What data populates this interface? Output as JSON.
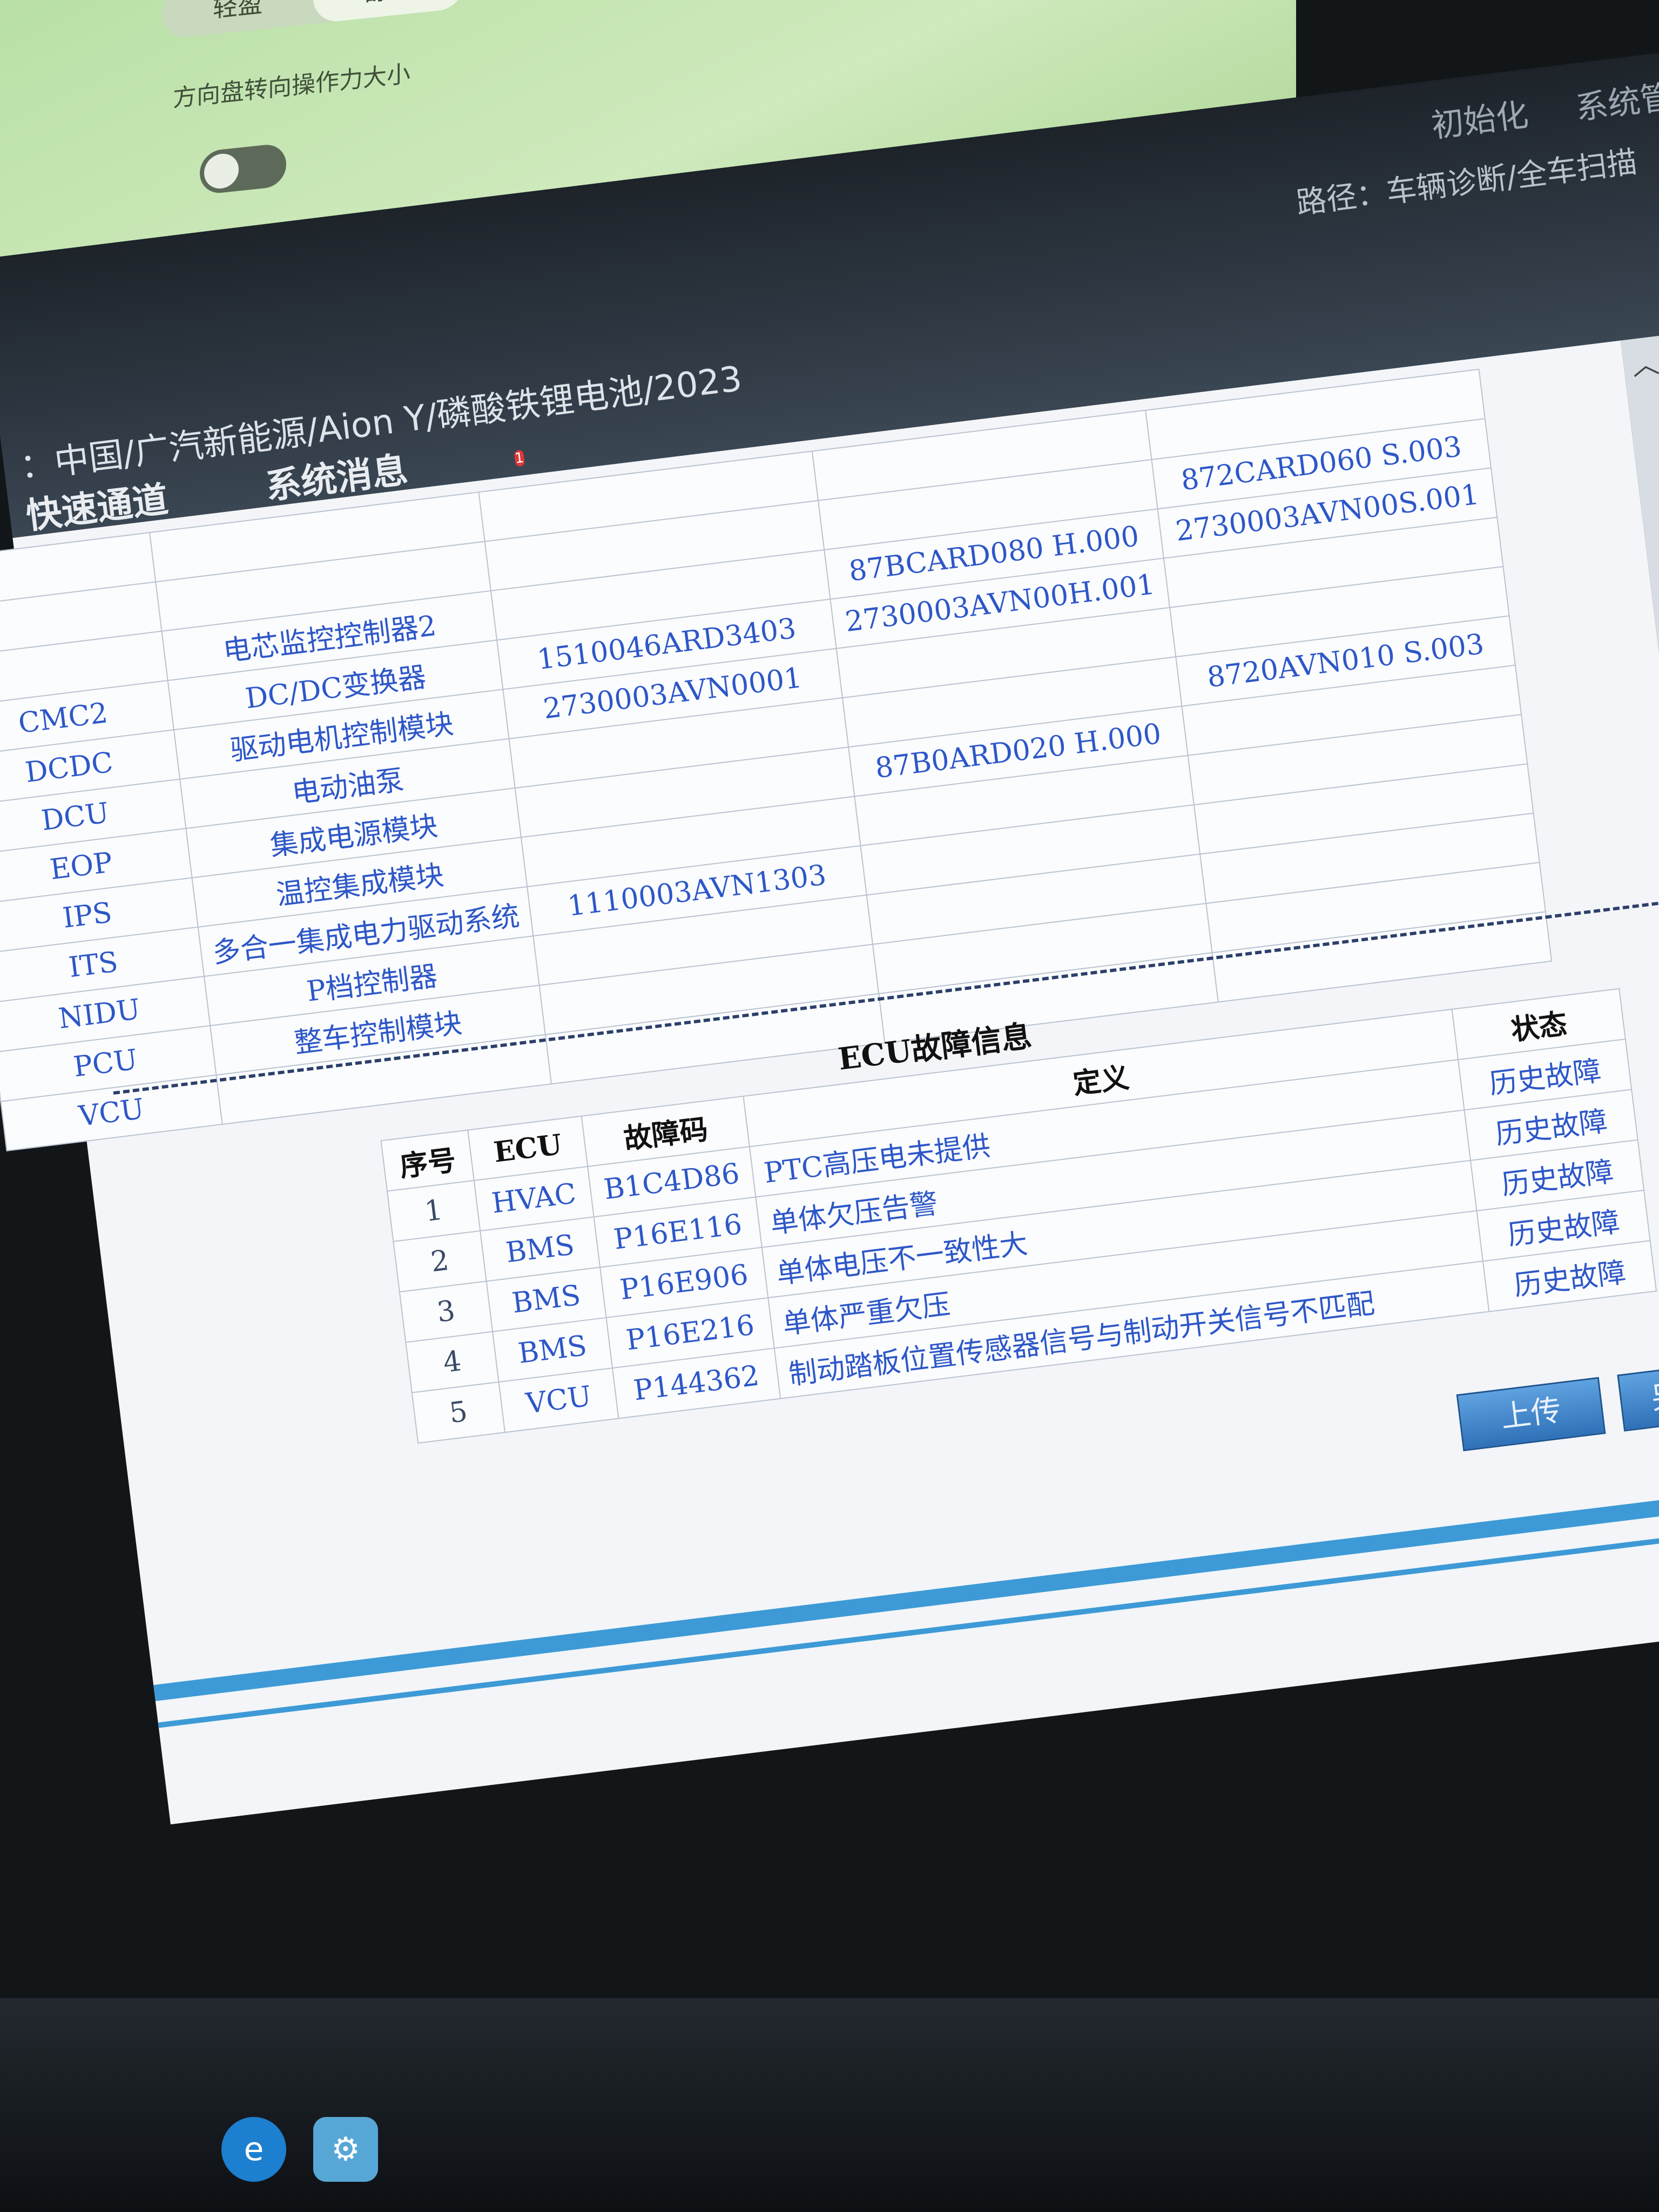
{
  "tablet": {
    "option_light": "轻盈",
    "option_comfort": "舒适",
    "setting_label": "方向盘转向操作力大小"
  },
  "header": {
    "menu": [
      "初始化",
      "系统管理"
    ],
    "path": "路径：车辆诊断/全车扫描",
    "vehicle": "：中国/广汽新能源/Aion Y/磷酸铁锂电池/2023",
    "tabs": [
      "快速通道",
      "系统消息"
    ],
    "badge_count": "1"
  },
  "ecu_table": {
    "rows": [
      {
        "abbr": "",
        "name": "",
        "hw": "",
        "sw": "",
        "ver": ""
      },
      {
        "abbr": "",
        "name": "",
        "hw": "",
        "sw": "",
        "ver": "872CARD060 S.003"
      },
      {
        "abbr": "",
        "name": "电芯监控控制器2",
        "hw": "",
        "sw": "87BCARD080 H.000",
        "ver": "2730003AVN00S.001"
      },
      {
        "abbr": "CMC2",
        "name": "DC/DC变换器",
        "hw": "1510046ARD3403",
        "sw": "2730003AVN00H.001",
        "ver": ""
      },
      {
        "abbr": "DCDC",
        "name": "驱动电机控制模块",
        "hw": "2730003AVN0001",
        "sw": "",
        "ver": ""
      },
      {
        "abbr": "DCU",
        "name": "电动油泵",
        "hw": "",
        "sw": "",
        "ver": "8720AVN010 S.003"
      },
      {
        "abbr": "EOP",
        "name": "集成电源模块",
        "hw": "",
        "sw": "87B0ARD020 H.000",
        "ver": ""
      },
      {
        "abbr": "IPS",
        "name": "温控集成模块",
        "hw": "",
        "sw": "",
        "ver": ""
      },
      {
        "abbr": "ITS",
        "name": "多合一集成电力驱动系统",
        "hw": "1110003AVN1303",
        "sw": "",
        "ver": ""
      },
      {
        "abbr": "NIDU",
        "name": "P档控制器",
        "hw": "",
        "sw": "",
        "ver": ""
      },
      {
        "abbr": "PCU",
        "name": "整车控制模块",
        "hw": "",
        "sw": "",
        "ver": ""
      },
      {
        "abbr": "VCU",
        "name": "",
        "hw": "",
        "sw": "",
        "ver": ""
      }
    ]
  },
  "fault": {
    "title": "ECU故障信息",
    "headers": {
      "no": "序号",
      "ecu": "ECU",
      "code": "故障码",
      "def": "定义",
      "state": "状态"
    },
    "rows": [
      {
        "no": "1",
        "ecu": "HVAC",
        "code": "B1C4D86",
        "def": "PTC高压电未提供",
        "state": "历史故障"
      },
      {
        "no": "2",
        "ecu": "BMS",
        "code": "P16E116",
        "def": "单体欠压告警",
        "state": "历史故障"
      },
      {
        "no": "3",
        "ecu": "BMS",
        "code": "P16E906",
        "def": "单体电压不一致性大",
        "state": "历史故障"
      },
      {
        "no": "4",
        "ecu": "BMS",
        "code": "P16E216",
        "def": "单体严重欠压",
        "state": "历史故障"
      },
      {
        "no": "5",
        "ecu": "VCU",
        "code": "P144362",
        "def": "制动踏板位置传感器信号与制动开关信号不匹配",
        "state": "历史故障"
      }
    ]
  },
  "buttons": {
    "upload": "上传",
    "save": "另存"
  }
}
